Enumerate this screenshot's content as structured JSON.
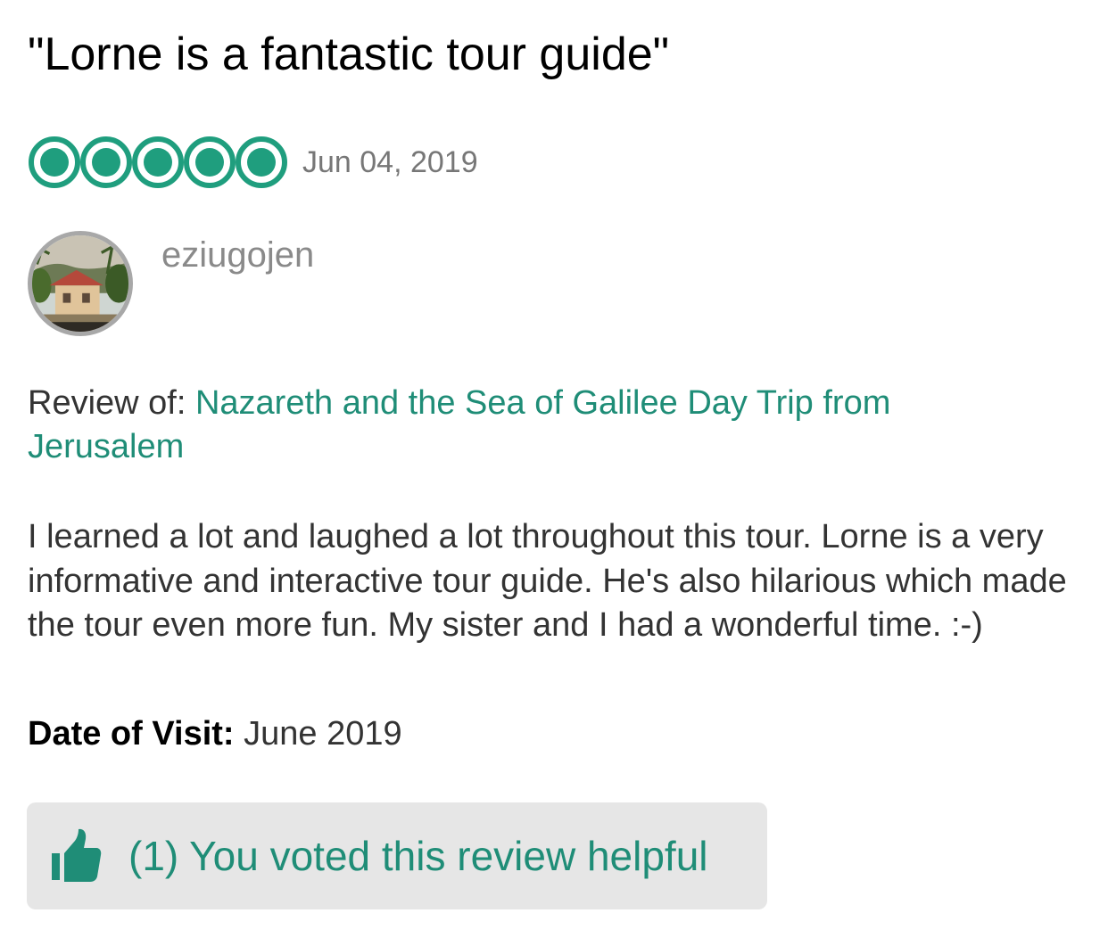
{
  "review": {
    "title": "\"Lorne is a fantastic tour guide\"",
    "rating": 5,
    "rating_max": 5,
    "date": "Jun 04, 2019",
    "rating_color": "#1f9e7e"
  },
  "user": {
    "name": "eziugojen",
    "avatar_icon": "user-avatar-photo"
  },
  "review_of": {
    "label": "Review of: ",
    "link_text": "Nazareth and the Sea of Galilee Day Trip from Jerusalem",
    "link_color": "#1f8d77"
  },
  "body": "I learned a lot and laughed a lot throughout this tour. Lorne is a very informative and interactive tour guide. He's also hilarious which made the tour even more fun. My sister and I had a wonderful time. :-)",
  "visit": {
    "label": "Date of Visit:",
    "value": " June 2019"
  },
  "helpful": {
    "text": "(1) You voted this review helpful",
    "icon": "thumbs-up-icon"
  }
}
